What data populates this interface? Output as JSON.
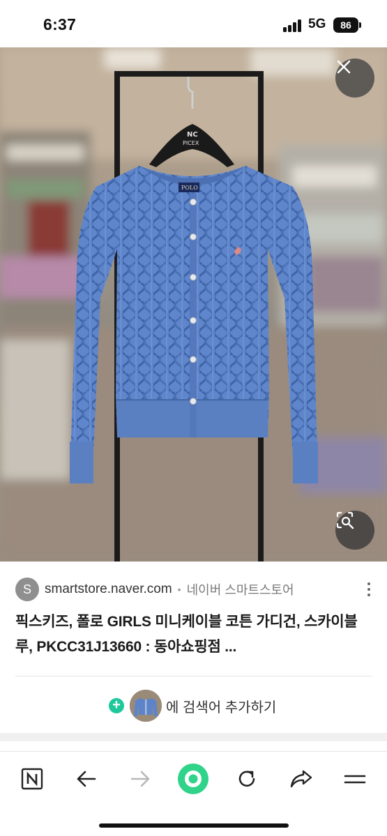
{
  "status": {
    "time": "6:37",
    "network": "5G",
    "battery": "86"
  },
  "viewer": {
    "close_icon": "close-icon",
    "lens_icon": "image-search-icon"
  },
  "result": {
    "source_avatar": "S",
    "source_domain": "smartstore.naver.com",
    "source_separator": "•",
    "source_name": "네이버 스마트스토어",
    "title": "픽스키즈, 폴로 GIRLS 미니케이블 코튼 가디건, 스카이블루, PKCC31J13660 : 동아쇼핑점 ..."
  },
  "add_search": {
    "label": "에 검색어 추가하기",
    "plus_icon": "plus-circle-icon"
  },
  "toolbar": {
    "items": [
      "naver-n-icon",
      "back-arrow-icon",
      "forward-arrow-icon",
      "green-home-icon",
      "refresh-icon",
      "share-icon",
      "menu-icon"
    ]
  },
  "colors": {
    "accent_green": "#1ec89b",
    "cardigan_blue": "#5d84c9"
  }
}
